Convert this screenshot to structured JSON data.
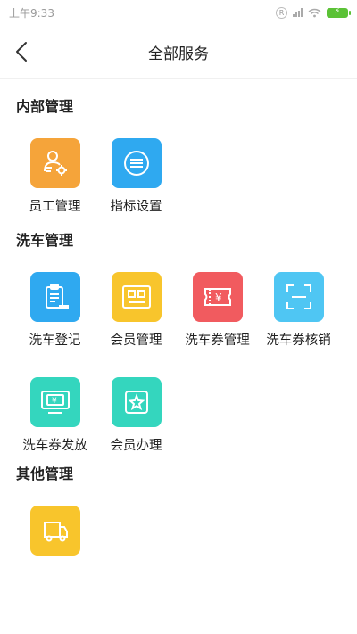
{
  "status_bar": {
    "time": "上午9:33",
    "r_badge": "R",
    "colors": {
      "text": "#999999",
      "battery": "#5bc236"
    }
  },
  "nav": {
    "title": "全部服务",
    "back_icon": "chevron-left-icon"
  },
  "sections": [
    {
      "title": "内部管理",
      "items": [
        {
          "label": "员工管理",
          "icon": "employee-gear-icon",
          "color": "#f5a43a"
        },
        {
          "label": "指标设置",
          "icon": "list-circle-icon",
          "color": "#2fa9f0"
        }
      ]
    },
    {
      "title": "洗车管理",
      "items": [
        {
          "label": "洗车登记",
          "icon": "clipboard-car-icon",
          "color": "#2fa9f0"
        },
        {
          "label": "会员管理",
          "icon": "member-card-icon",
          "color": "#f8c52c"
        },
        {
          "label": "洗车券管理",
          "icon": "coupon-yen-icon",
          "color": "#f15b5f"
        },
        {
          "label": "洗车券核销",
          "icon": "scan-frame-icon",
          "color": "#4fc6f3"
        },
        {
          "label": "洗车券发放",
          "icon": "monitor-yen-icon",
          "color": "#34d6be"
        },
        {
          "label": "会员办理",
          "icon": "star-badge-icon",
          "color": "#34d6be"
        }
      ]
    },
    {
      "title": "其他管理",
      "items": [
        {
          "label": "",
          "icon": "truck-icon",
          "color": "#f8c52c"
        }
      ]
    }
  ]
}
